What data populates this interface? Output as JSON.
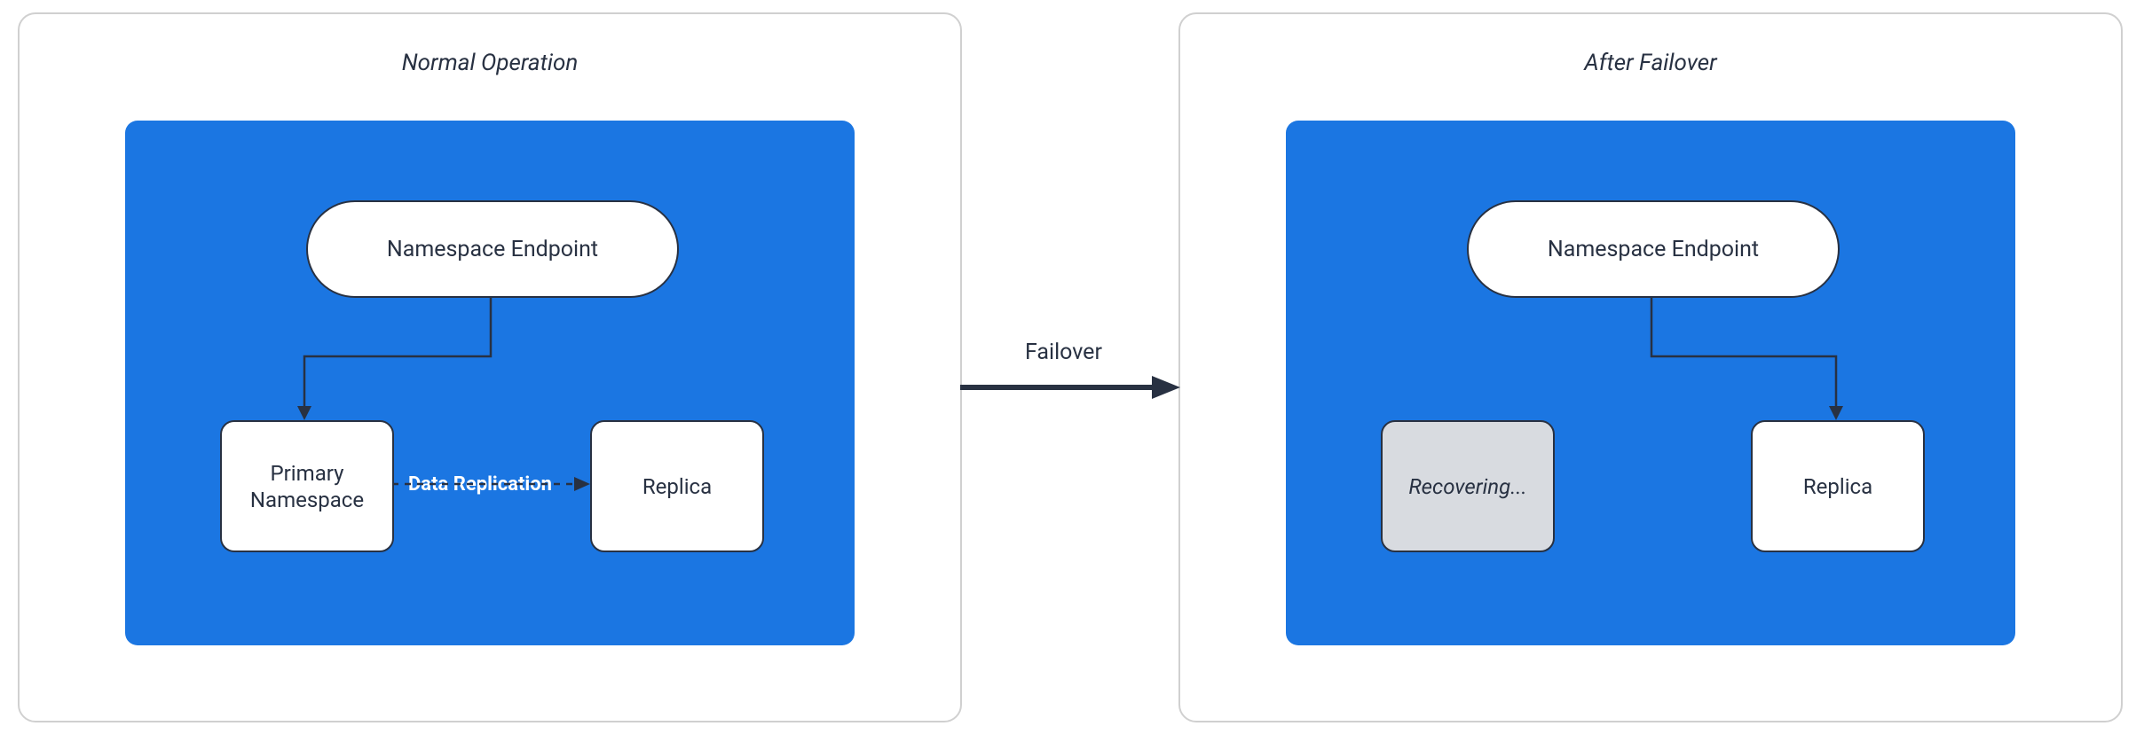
{
  "left": {
    "title": "Normal Operation",
    "endpoint_label": "Namespace Endpoint",
    "primary_label": "Primary\nNamespace",
    "replica_label": "Replica",
    "replication_label": "Data Replication"
  },
  "right": {
    "title": "After Failover",
    "endpoint_label": "Namespace Endpoint",
    "recovering_label": "Recovering...",
    "replica_label": "Replica"
  },
  "failover_label": "Failover"
}
